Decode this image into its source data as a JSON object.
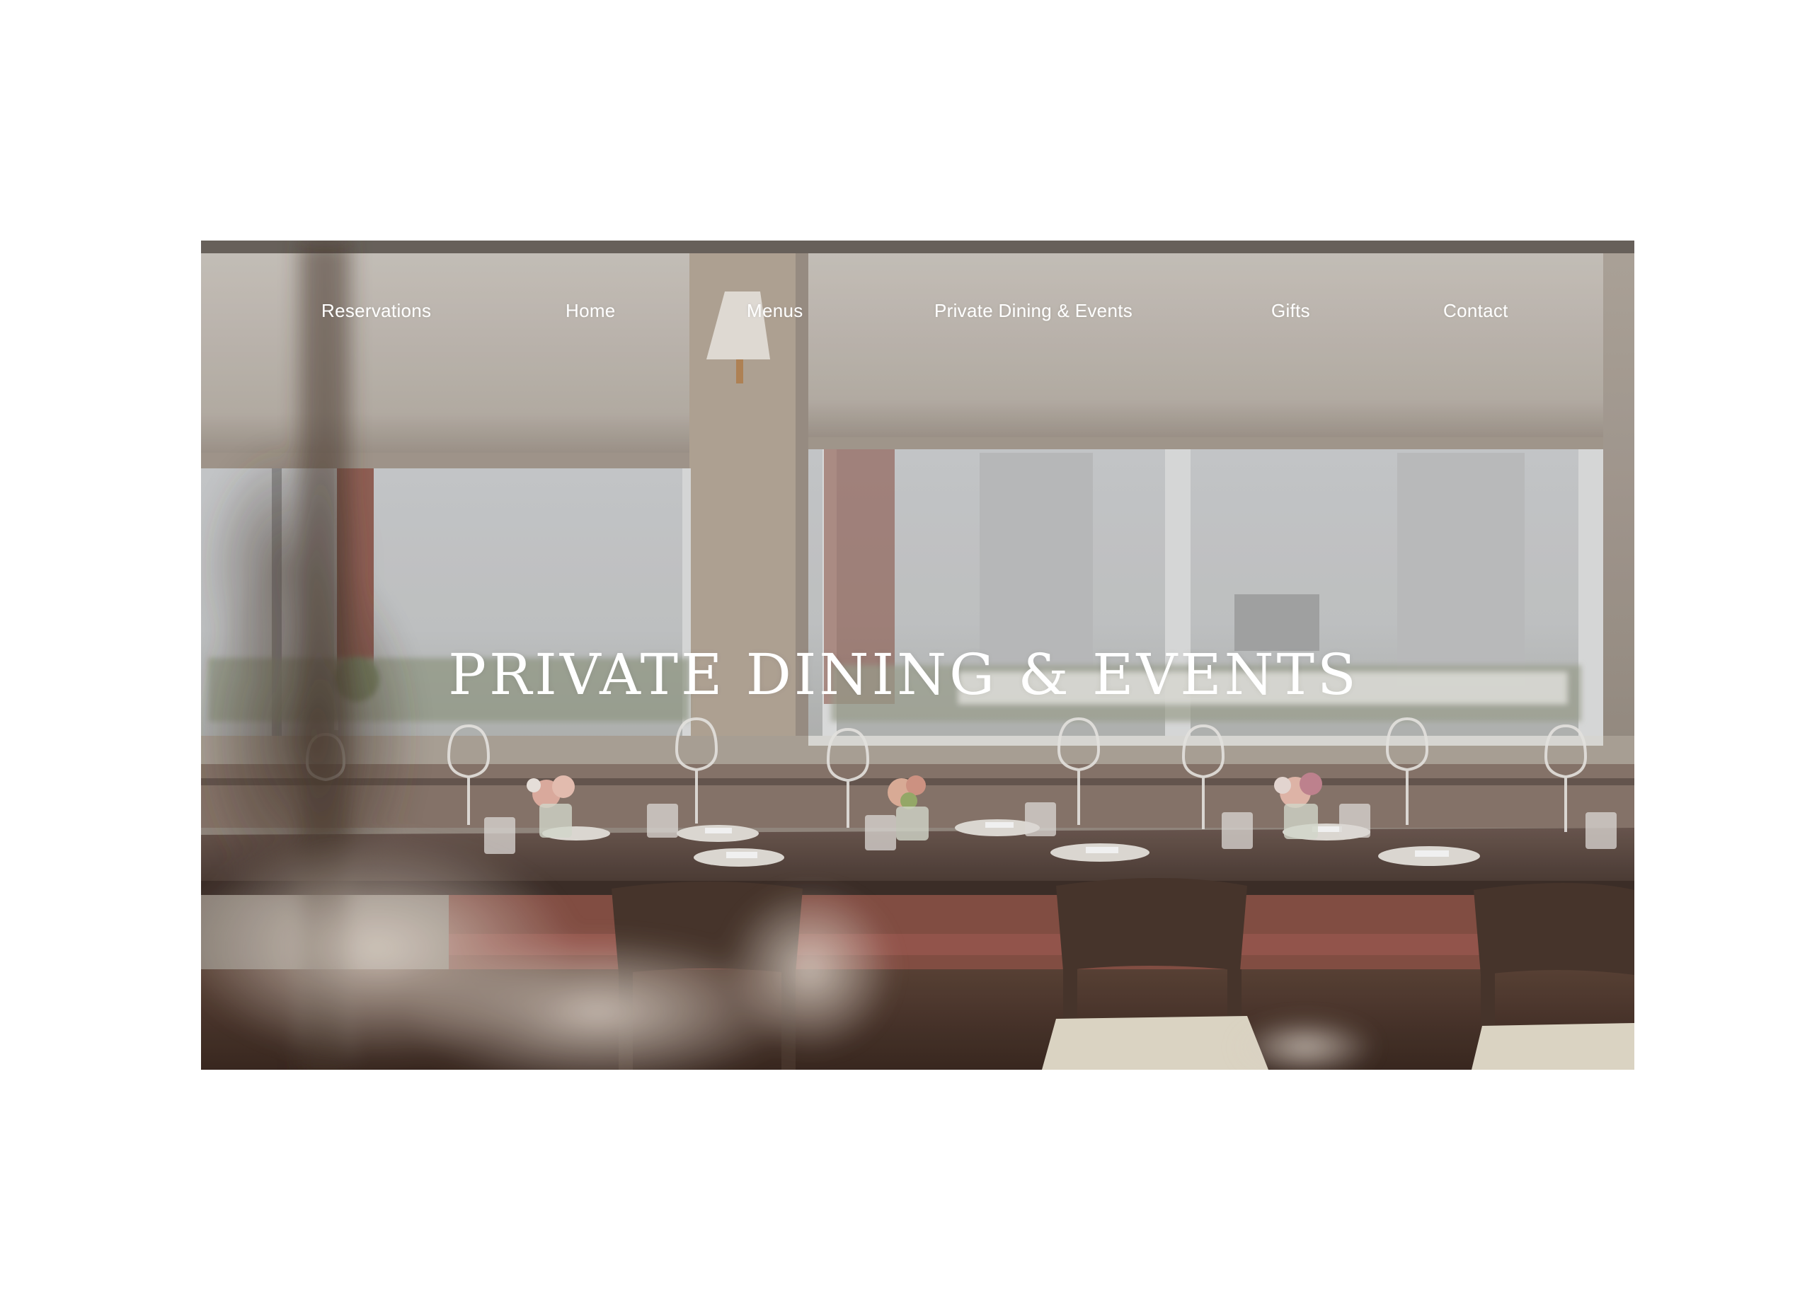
{
  "nav": {
    "items": [
      {
        "label": "Reservations"
      },
      {
        "label": "Home"
      },
      {
        "label": "Menus"
      },
      {
        "label": "Private Dining & Events"
      },
      {
        "label": "Gifts"
      },
      {
        "label": "Contact"
      }
    ]
  },
  "hero": {
    "title": "PRIVATE DINING & EVENTS"
  },
  "colors": {
    "page_background": "#ffffff",
    "nav_text": "#ffffff",
    "title_text": "#ffffff"
  }
}
